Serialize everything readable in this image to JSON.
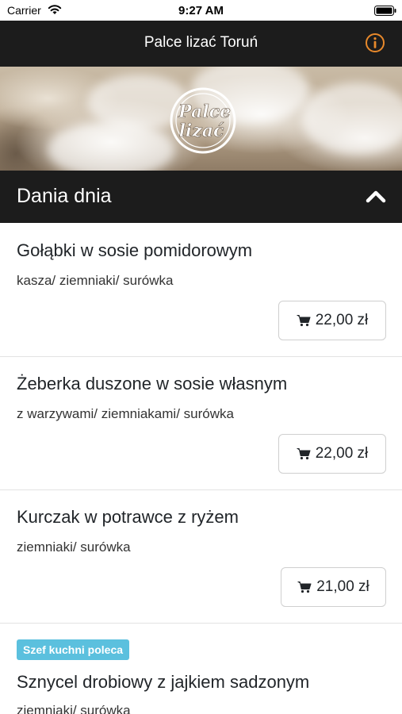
{
  "status_bar": {
    "carrier": "Carrier",
    "time": "9:27 AM"
  },
  "nav": {
    "title": "Palce lizać Toruń",
    "info_icon": "info-icon"
  },
  "hero": {
    "logo_line1": "Palce",
    "logo_line2": "lizać"
  },
  "section": {
    "title": "Dania dnia",
    "collapse_icon": "chevron-up-icon"
  },
  "menu_items": [
    {
      "name": "Gołąbki w sosie pomidorowym",
      "description": "kasza/ ziemniaki/ surówka",
      "price": "22,00 zł"
    },
    {
      "name": "Żeberka duszone w sosie własnym",
      "description": "z warzywami/ ziemniakami/ surówka",
      "price": "22,00 zł"
    },
    {
      "name": "Kurczak w potrawce z ryżem",
      "description": "ziemniaki/ surówka",
      "price": "21,00 zł"
    },
    {
      "badge": "Szef kuchni poleca",
      "name": "Sznycel drobiowy z jajkiem sadzonym",
      "description": "ziemniaki/ surówka"
    }
  ],
  "colors": {
    "dark_bar": "#1c1c1c",
    "accent_orange": "#e8892b",
    "badge_blue": "#5bc0de"
  }
}
